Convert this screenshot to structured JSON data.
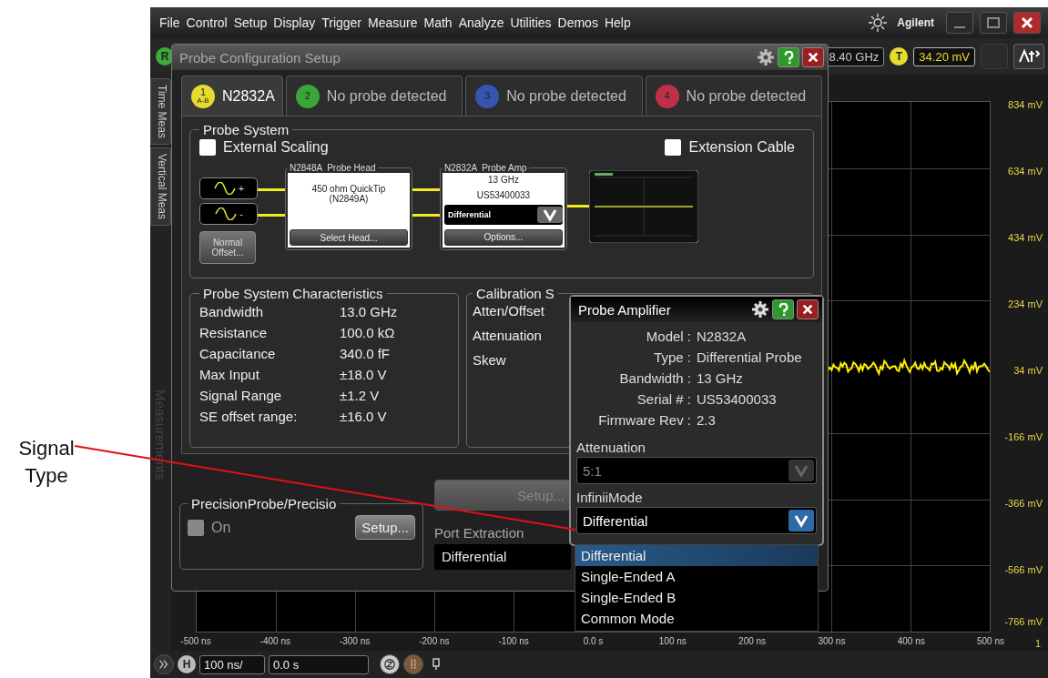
{
  "menu": [
    "File",
    "Control",
    "Setup",
    "Display",
    "Trigger",
    "Measure",
    "Math",
    "Analyze",
    "Utilities",
    "Demos",
    "Help"
  ],
  "brand": "Agilent",
  "toolbar": {
    "run_badge": "R",
    "frequency": "8.40 GHz",
    "trigger_badge": "T",
    "trigger_level": "34.20 mV"
  },
  "side_tabs": [
    {
      "label": "Time Meas",
      "disabled": false
    },
    {
      "label": "Vertical Meas",
      "disabled": false
    },
    {
      "label": "Measurements",
      "disabled": true
    }
  ],
  "graticule": {
    "y_labels": [
      "834 mV",
      "634 mV",
      "434 mV",
      "234 mV",
      "34 mV",
      "-166 mV",
      "-366 mV",
      "-566 mV",
      "-766 mV"
    ],
    "x_labels": [
      "-500 ns",
      "-400 ns",
      "-300 ns",
      "-200 ns",
      "-100 ns",
      "0.0 s",
      "100 ns",
      "200 ns",
      "300 ns",
      "400 ns",
      "500 ns"
    ],
    "channel": "1"
  },
  "timebase": {
    "badge": "H",
    "scale": "100 ns/",
    "position": "0.0 s"
  },
  "probe_config": {
    "title": "Probe Configuration Setup",
    "tabs": [
      {
        "badge": "1",
        "sub": "A-B",
        "label": "N2832A",
        "color": "#e6dc2e",
        "selected": true
      },
      {
        "badge": "2",
        "label": "No probe detected",
        "color": "#3aa53a",
        "selected": false
      },
      {
        "badge": "3",
        "label": "No probe detected",
        "color": "#3555b0",
        "selected": false
      },
      {
        "badge": "4",
        "label": "No probe detected",
        "color": "#c0304a",
        "selected": false
      }
    ],
    "probe_system": {
      "title": "Probe System",
      "options": [
        {
          "label": "External Scaling",
          "checked": false
        },
        {
          "label": "Extension Cable",
          "checked": false
        }
      ],
      "inputs": [
        "+",
        "-"
      ],
      "offset_button": "Normal Offset...",
      "head": {
        "title": "N2848A  Probe Head",
        "text": "450 ohm QuickTip (N2849A)",
        "button": "Select Head..."
      },
      "amp": {
        "title": "N2832A  Probe Amp",
        "lines": [
          "13 GHz",
          "US53400033"
        ],
        "mode": "Differential",
        "button": "Options..."
      }
    },
    "characteristics": {
      "title": "Probe System Characteristics",
      "rows": [
        {
          "label": "Bandwidth",
          "value": "13.0 GHz"
        },
        {
          "label": "Resistance",
          "value": "100.0 kΩ"
        },
        {
          "label": "Capacitance",
          "value": "340.0 fF"
        },
        {
          "label": "Max Input",
          "value": "±18.0 V"
        },
        {
          "label": "Signal Range",
          "value": "±1.2 V"
        },
        {
          "label": "SE offset range:",
          "value": "±16.0 V"
        }
      ]
    },
    "calibration": {
      "title": "Calibration S",
      "rows": [
        "Atten/Offset",
        "Attenuation",
        "Skew"
      ]
    },
    "precision": {
      "title": "PrecisionProbe/Precisio",
      "checkbox": {
        "label": "On",
        "checked": false,
        "disabled": true
      },
      "button": "Setup..."
    },
    "port": {
      "button": {
        "label": "Setup...",
        "disabled": true
      },
      "label": "Port Extraction",
      "value": "Differential"
    }
  },
  "probe_amp": {
    "title": "Probe Amplifier",
    "info": [
      {
        "label": "Model :",
        "value": "N2832A"
      },
      {
        "label": "Type :",
        "value": "Differential Probe"
      },
      {
        "label": "Bandwidth :",
        "value": "13 GHz"
      },
      {
        "label": "Serial # :",
        "value": "US53400033"
      },
      {
        "label": "Firmware Rev :",
        "value": "2.3"
      }
    ],
    "attenuation": {
      "label": "Attenuation",
      "value": "5:1",
      "disabled": true
    },
    "mode": {
      "label": "InfiniiMode",
      "value": "Differential",
      "disabled": false,
      "options": [
        {
          "label": "Differential",
          "selected": true
        },
        {
          "label": "Single-Ended A",
          "selected": false
        },
        {
          "label": "Single-Ended B",
          "selected": false
        },
        {
          "label": "Common Mode",
          "selected": false
        }
      ]
    }
  },
  "annotation": "Signal Type"
}
